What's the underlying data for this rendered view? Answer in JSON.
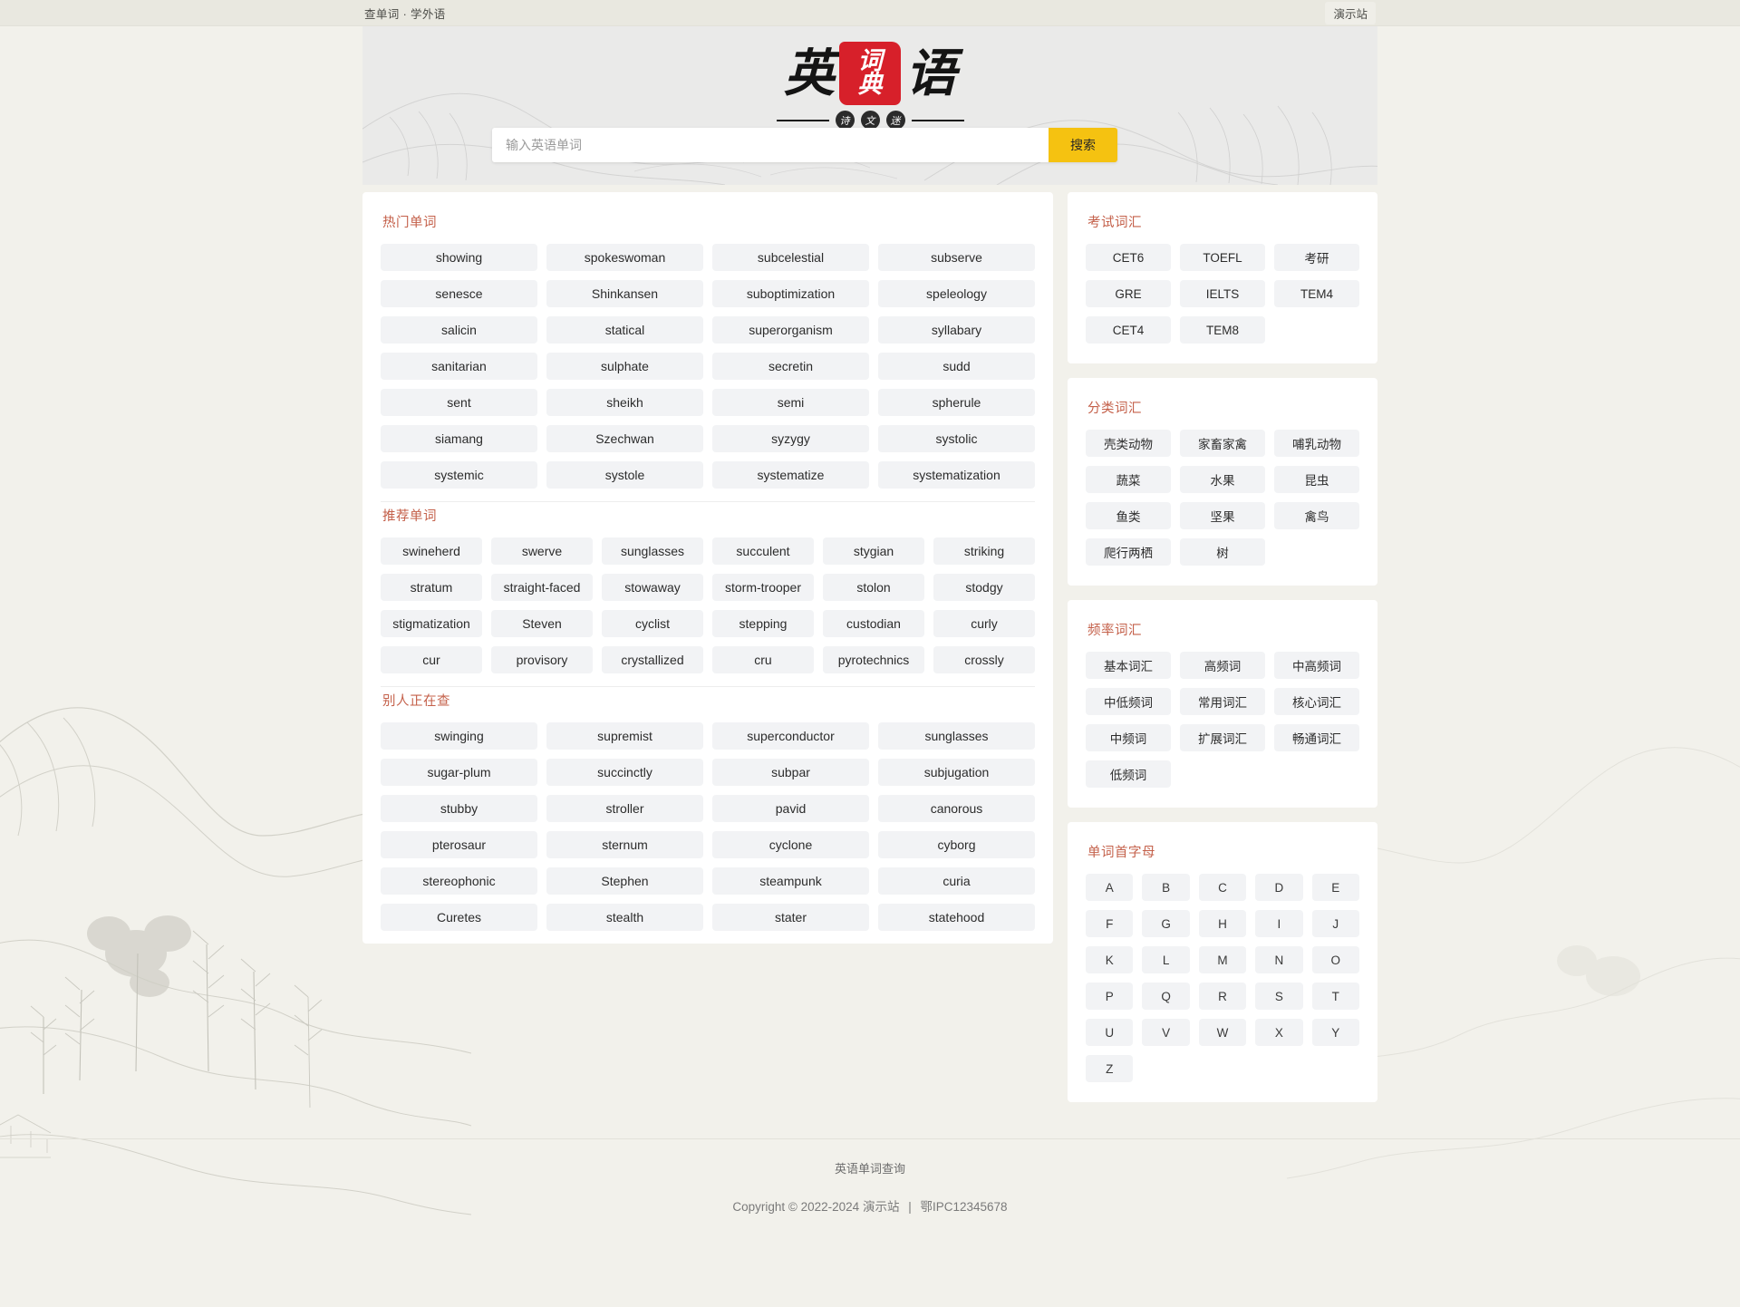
{
  "topbar": {
    "left_text": "查单词 · 学外语",
    "right_label": "演示站"
  },
  "logo": {
    "char_left": "英",
    "char_right": "语",
    "seal_top": "词",
    "seal_bottom": "典",
    "sub_chars": [
      "诗",
      "文",
      "迷"
    ]
  },
  "search": {
    "placeholder": "输入英语单词",
    "button_label": "搜索"
  },
  "colors": {
    "accent_red": "#c4604a",
    "seal_red": "#d7202a",
    "search_button": "#f5c211",
    "chip_bg": "#f2f3f5",
    "page_bg": "#f1f0ea"
  },
  "sections": {
    "hot": {
      "title": "热门单词",
      "words": [
        "showing",
        "spokeswoman",
        "subcelestial",
        "subserve",
        "senesce",
        "Shinkansen",
        "suboptimization",
        "speleology",
        "salicin",
        "statical",
        "superorganism",
        "syllabary",
        "sanitarian",
        "sulphate",
        "secretin",
        "sudd",
        "sent",
        "sheikh",
        "semi",
        "spherule",
        "siamang",
        "Szechwan",
        "syzygy",
        "systolic",
        "systemic",
        "systole",
        "systematize",
        "systematization"
      ]
    },
    "recommended": {
      "title": "推荐单词",
      "words": [
        "swineherd",
        "swerve",
        "sunglasses",
        "succulent",
        "stygian",
        "striking",
        "stratum",
        "straight-faced",
        "stowaway",
        "storm-trooper",
        "stolon",
        "stodgy",
        "stigmatization",
        "Steven",
        "cyclist",
        "stepping",
        "custodian",
        "curly",
        "cur",
        "provisory",
        "crystallized",
        "cru",
        "pyrotechnics",
        "crossly"
      ]
    },
    "others_searching": {
      "title": "别人正在查",
      "words": [
        "swinging",
        "supremist",
        "superconductor",
        "sunglasses",
        "sugar-plum",
        "succinctly",
        "subpar",
        "subjugation",
        "stubby",
        "stroller",
        "pavid",
        "canorous",
        "pterosaur",
        "sternum",
        "cyclone",
        "cyborg",
        "stereophonic",
        "Stephen",
        "steampunk",
        "curia",
        "Curetes",
        "stealth",
        "stater",
        "statehood"
      ]
    }
  },
  "sidebar": {
    "exam": {
      "title": "考试词汇",
      "items": [
        "CET6",
        "TOEFL",
        "考研",
        "GRE",
        "IELTS",
        "TEM4",
        "CET4",
        "TEM8"
      ]
    },
    "category": {
      "title": "分类词汇",
      "items": [
        "壳类动物",
        "家畜家禽",
        "哺乳动物",
        "蔬菜",
        "水果",
        "昆虫",
        "鱼类",
        "坚果",
        "禽鸟",
        "爬行两栖",
        "树"
      ]
    },
    "frequency": {
      "title": "频率词汇",
      "items": [
        "基本词汇",
        "高频词",
        "中高频词",
        "中低频词",
        "常用词汇",
        "核心词汇",
        "中频词",
        "扩展词汇",
        "畅通词汇",
        "低频词"
      ]
    },
    "alphabet": {
      "title": "单词首字母",
      "items": [
        "A",
        "B",
        "C",
        "D",
        "E",
        "F",
        "G",
        "H",
        "I",
        "J",
        "K",
        "L",
        "M",
        "N",
        "O",
        "P",
        "Q",
        "R",
        "S",
        "T",
        "U",
        "V",
        "W",
        "X",
        "Y",
        "Z"
      ]
    }
  },
  "footer": {
    "link_text": "英语单词查询",
    "copyright": "Copyright © 2022-2024 演示站",
    "separator": "|",
    "icp": "鄂IPC12345678"
  }
}
